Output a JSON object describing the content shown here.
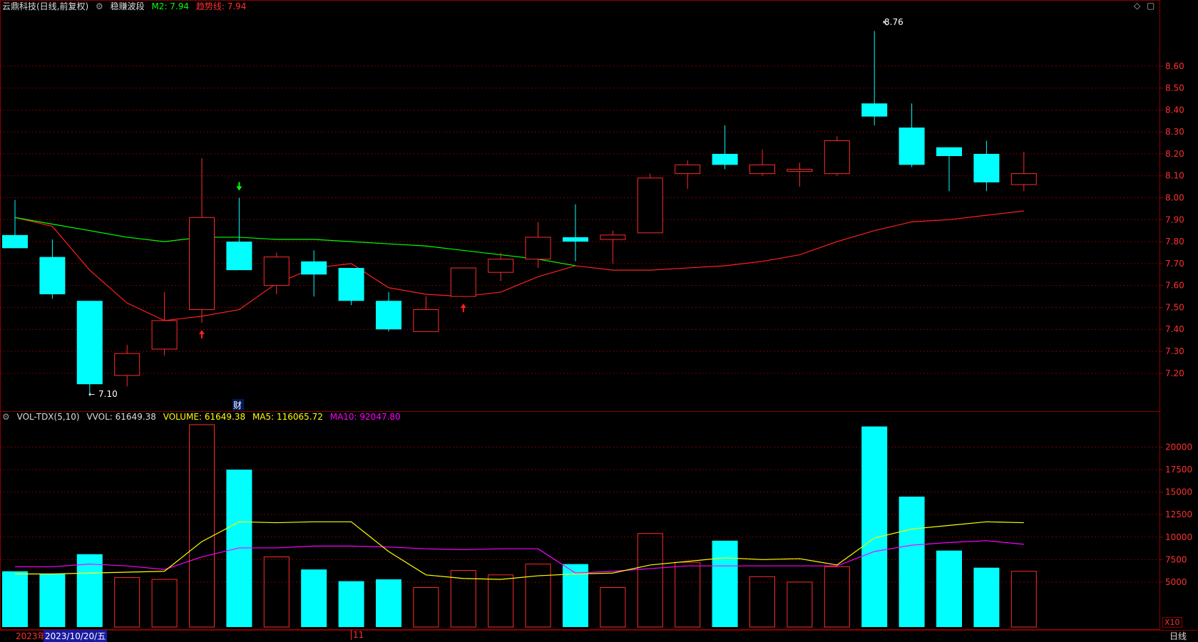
{
  "title_bar": {
    "stock": "云鼎科技(日线,前复权)",
    "indicator": "稳赚波段",
    "m2_label": "M2: 7.94",
    "trend_label": "趋势线: 7.94"
  },
  "colors": {
    "background": "#000000",
    "up": "#ff2b2b",
    "down": "#00ffff",
    "grid": "#7a0000",
    "m2_line": "#00ff00",
    "trend_line": "#ff2020",
    "ma5": "#ffff00",
    "ma10": "#ff00ff",
    "axis_text": "#ff3030"
  },
  "price_axis": {
    "ticks": [
      "8.60",
      "8.50",
      "8.40",
      "8.30",
      "8.20",
      "8.10",
      "8.00",
      "7.90",
      "7.80",
      "7.70",
      "7.60",
      "7.50",
      "7.40",
      "7.30",
      "7.20"
    ],
    "max_label": "8.76",
    "min_label": "7.10"
  },
  "volume_panel": {
    "title": "VOL-TDX(5,10)",
    "vvol": "VVOL: 61649.38",
    "volume": "VOLUME: 61649.38",
    "ma5": "MA5: 116065.72",
    "ma10": "MA10: 92047.80",
    "ticks": [
      "20000",
      "17500",
      "15000",
      "12500",
      "10000",
      "7500",
      "5000"
    ],
    "unit": "X10"
  },
  "bottom_bar": {
    "year": "2023年",
    "date": "2023/10/20/五",
    "month_mark": "11",
    "period": "日线"
  },
  "annotations": {
    "finance_mark": "财"
  },
  "chart_data": {
    "type": "candlestick",
    "price_ylim": [
      7.05,
      8.83
    ],
    "volume_ylim": [
      0,
      22500
    ],
    "candles": [
      {
        "open": 7.83,
        "close": 7.77,
        "high": 7.99,
        "low": 7.77,
        "volume": 6200
      },
      {
        "open": 7.73,
        "close": 7.56,
        "high": 7.81,
        "low": 7.54,
        "volume": 5900
      },
      {
        "open": 7.53,
        "close": 7.15,
        "high": 7.53,
        "low": 7.1,
        "volume": 8100
      },
      {
        "open": 7.19,
        "close": 7.29,
        "high": 7.33,
        "low": 7.14,
        "volume": 5500
      },
      {
        "open": 7.31,
        "close": 7.44,
        "high": 7.57,
        "low": 7.28,
        "volume": 5300
      },
      {
        "open": 7.49,
        "close": 7.91,
        "high": 8.18,
        "low": 7.43,
        "volume": 22500
      },
      {
        "open": 7.8,
        "close": 7.67,
        "high": 8.0,
        "low": 7.67,
        "volume": 17500
      },
      {
        "open": 7.6,
        "close": 7.73,
        "high": 7.75,
        "low": 7.56,
        "volume": 7800
      },
      {
        "open": 7.71,
        "close": 7.65,
        "high": 7.76,
        "low": 7.55,
        "volume": 6400
      },
      {
        "open": 7.68,
        "close": 7.53,
        "high": 7.68,
        "low": 7.51,
        "volume": 5100
      },
      {
        "open": 7.53,
        "close": 7.4,
        "high": 7.57,
        "low": 7.39,
        "volume": 5300
      },
      {
        "open": 7.39,
        "close": 7.49,
        "high": 7.55,
        "low": 7.39,
        "volume": 4400
      },
      {
        "open": 7.55,
        "close": 7.68,
        "high": 7.68,
        "low": 7.55,
        "volume": 6300
      },
      {
        "open": 7.66,
        "close": 7.72,
        "high": 7.75,
        "low": 7.62,
        "volume": 5800
      },
      {
        "open": 7.72,
        "close": 7.82,
        "high": 7.89,
        "low": 7.68,
        "volume": 7000
      },
      {
        "open": 7.82,
        "close": 7.8,
        "high": 7.97,
        "low": 7.71,
        "volume": 7000
      },
      {
        "open": 7.81,
        "close": 7.83,
        "high": 7.85,
        "low": 7.7,
        "volume": 4400
      },
      {
        "open": 7.84,
        "close": 8.09,
        "high": 8.11,
        "low": 7.84,
        "volume": 10400
      },
      {
        "open": 8.11,
        "close": 8.15,
        "high": 8.17,
        "low": 8.04,
        "volume": 7200
      },
      {
        "open": 8.2,
        "close": 8.15,
        "high": 8.33,
        "low": 8.13,
        "volume": 9600
      },
      {
        "open": 8.11,
        "close": 8.15,
        "high": 8.22,
        "low": 8.1,
        "volume": 5600
      },
      {
        "open": 8.12,
        "close": 8.13,
        "high": 8.16,
        "low": 8.05,
        "volume": 5000
      },
      {
        "open": 8.11,
        "close": 8.26,
        "high": 8.28,
        "low": 8.1,
        "volume": 6700
      },
      {
        "open": 8.43,
        "close": 8.37,
        "high": 8.76,
        "low": 8.33,
        "volume": 22300
      },
      {
        "open": 8.32,
        "close": 8.15,
        "high": 8.43,
        "low": 8.14,
        "volume": 14500
      },
      {
        "open": 8.23,
        "close": 8.19,
        "high": 8.23,
        "low": 8.03,
        "volume": 8500
      },
      {
        "open": 8.2,
        "close": 8.07,
        "high": 8.26,
        "low": 8.03,
        "volume": 6600
      },
      {
        "open": 8.06,
        "close": 8.11,
        "high": 8.21,
        "low": 8.03,
        "volume": 6200
      }
    ],
    "m2_line": [
      [
        0,
        7.91
      ],
      [
        1,
        7.88
      ],
      [
        2,
        7.85
      ],
      [
        3,
        7.82
      ],
      [
        4,
        7.8
      ],
      [
        5,
        7.82
      ],
      [
        6,
        7.82
      ],
      [
        7,
        7.81
      ],
      [
        8,
        7.81
      ],
      [
        9,
        7.8
      ],
      [
        10,
        7.79
      ],
      [
        11,
        7.78
      ],
      [
        12,
        7.76
      ],
      [
        13,
        7.74
      ],
      [
        14,
        7.72
      ],
      [
        15,
        7.69
      ]
    ],
    "trend_line": [
      [
        0,
        7.91
      ],
      [
        1,
        7.87
      ],
      [
        2,
        7.67
      ],
      [
        3,
        7.52
      ],
      [
        4,
        7.44
      ],
      [
        5,
        7.46
      ],
      [
        6,
        7.49
      ],
      [
        7,
        7.61
      ],
      [
        8,
        7.68
      ],
      [
        9,
        7.7
      ],
      [
        10,
        7.59
      ],
      [
        11,
        7.56
      ],
      [
        12,
        7.55
      ],
      [
        13,
        7.57
      ],
      [
        14,
        7.64
      ],
      [
        15,
        7.69
      ],
      [
        16,
        7.67
      ],
      [
        17,
        7.67
      ],
      [
        18,
        7.68
      ],
      [
        19,
        7.69
      ],
      [
        20,
        7.71
      ],
      [
        21,
        7.74
      ],
      [
        22,
        7.8
      ],
      [
        23,
        7.85
      ],
      [
        24,
        7.89
      ],
      [
        25,
        7.9
      ],
      [
        26,
        7.92
      ],
      [
        27,
        7.94
      ]
    ],
    "ma5": [
      [
        0,
        5900
      ],
      [
        1,
        5900
      ],
      [
        2,
        6000
      ],
      [
        3,
        6100
      ],
      [
        4,
        6200
      ],
      [
        5,
        9500
      ],
      [
        6,
        11700
      ],
      [
        7,
        11600
      ],
      [
        8,
        11700
      ],
      [
        9,
        11700
      ],
      [
        10,
        8400
      ],
      [
        11,
        5800
      ],
      [
        12,
        5400
      ],
      [
        13,
        5300
      ],
      [
        14,
        5700
      ],
      [
        15,
        5900
      ],
      [
        16,
        6000
      ],
      [
        17,
        6900
      ],
      [
        18,
        7300
      ],
      [
        19,
        7700
      ],
      [
        20,
        7500
      ],
      [
        21,
        7600
      ],
      [
        22,
        6900
      ],
      [
        23,
        9900
      ],
      [
        24,
        10900
      ],
      [
        25,
        11300
      ],
      [
        26,
        11700
      ],
      [
        27,
        11600
      ]
    ],
    "ma10": [
      [
        0,
        6700
      ],
      [
        1,
        6700
      ],
      [
        2,
        7000
      ],
      [
        3,
        6800
      ],
      [
        4,
        6400
      ],
      [
        5,
        7800
      ],
      [
        6,
        8800
      ],
      [
        7,
        8800
      ],
      [
        8,
        9000
      ],
      [
        9,
        9000
      ],
      [
        10,
        8900
      ],
      [
        11,
        8700
      ],
      [
        12,
        8600
      ],
      [
        13,
        8700
      ],
      [
        14,
        8700
      ],
      [
        15,
        6000
      ],
      [
        16,
        6200
      ],
      [
        17,
        6500
      ],
      [
        18,
        6800
      ],
      [
        19,
        6800
      ],
      [
        20,
        6800
      ],
      [
        21,
        6800
      ],
      [
        22,
        6800
      ],
      [
        23,
        8400
      ],
      [
        24,
        9100
      ],
      [
        25,
        9400
      ],
      [
        26,
        9600
      ],
      [
        27,
        9200
      ]
    ],
    "signals": [
      {
        "index": 5,
        "type": "buy"
      },
      {
        "index": 6,
        "type": "sell"
      },
      {
        "index": 12,
        "type": "buy"
      }
    ]
  }
}
